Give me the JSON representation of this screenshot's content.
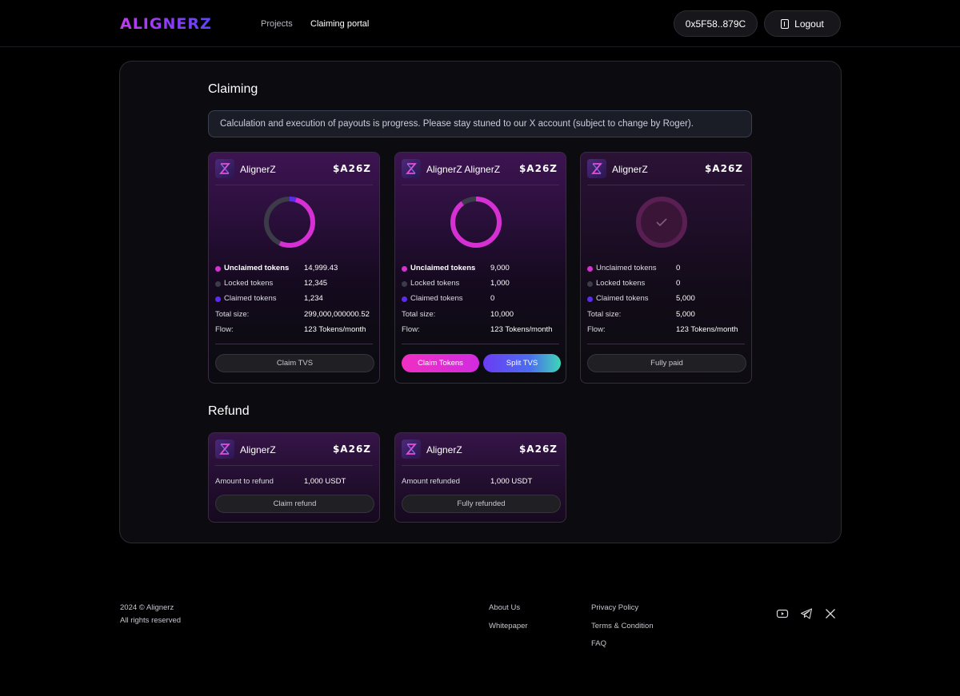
{
  "header": {
    "logo": "ALIGNERZ",
    "nav": [
      {
        "label": "Projects"
      },
      {
        "label": "Claiming portal"
      }
    ],
    "wallet": "0x5F58..879C",
    "logout_label": "Logout"
  },
  "claiming": {
    "title": "Claiming",
    "notice": "Calculation and execution of payouts is progress. Please stay stuned to our X account (subject to change by Roger).",
    "cards": [
      {
        "name": "AlignerZ",
        "ticker": "$A26Z",
        "progress": {
          "unclaimed": 14999.43,
          "locked": 12345,
          "claimed": 1234
        },
        "rows": [
          {
            "label": "Unclaimed tokens",
            "value": "14,999.43"
          },
          {
            "label": "Locked tokens",
            "value": "12,345"
          },
          {
            "label": "Claimed tokens",
            "value": "1,234"
          },
          {
            "label": "Total size:",
            "value": "299,000,000000.52"
          },
          {
            "label": "Flow:",
            "value": "123 Tokens/month"
          }
        ],
        "button": "Claim TVS"
      },
      {
        "name": "AlignerZ  AlignerZ",
        "ticker": "$A26Z",
        "progress": {
          "unclaimed": 9000,
          "locked": 1000,
          "claimed": 0
        },
        "rows": [
          {
            "label": "Unclaimed tokens",
            "value": "9,000"
          },
          {
            "label": "Locked tokens",
            "value": "1,000"
          },
          {
            "label": "Claimed tokens",
            "value": "0"
          },
          {
            "label": "Total size:",
            "value": "10,000"
          },
          {
            "label": "Flow:",
            "value": "123 Tokens/month"
          }
        ],
        "button_primary": "Claim Tokens",
        "button_secondary": "Split TVS"
      },
      {
        "name": "AlignerZ",
        "ticker": "$A26Z",
        "rows": [
          {
            "label": "Unclaimed tokens",
            "value": "0"
          },
          {
            "label": "Locked tokens",
            "value": "0"
          },
          {
            "label": "Claimed tokens",
            "value": "5,000"
          },
          {
            "label": "Total size:",
            "value": "5,000"
          },
          {
            "label": "Flow:",
            "value": "123 Tokens/month"
          }
        ],
        "button": "Fully paid"
      }
    ],
    "legend_colors": {
      "unclaimed": "#d62fd4",
      "locked": "#3c3c48",
      "claimed": "#5b2cf0"
    }
  },
  "refund": {
    "title": "Refund",
    "cards": [
      {
        "name": "AlignerZ",
        "ticker": "$A26Z",
        "label": "Amount to refund",
        "value": "1,000 USDT",
        "button": "Claim refund"
      },
      {
        "name": "AlignerZ",
        "ticker": "$A26Z",
        "label": "Amount refunded",
        "value": "1,000 USDT",
        "button": "Fully refunded"
      }
    ]
  },
  "footer": {
    "copyright": "2024 © Alignerz",
    "rights": "All rights reserved",
    "links_col1": [
      "About Us",
      "Whitepaper"
    ],
    "links_col2": [
      "Privacy Policy",
      "Terms & Condition",
      "FAQ"
    ],
    "socials": [
      "youtube-icon",
      "telegram-icon",
      "x-icon"
    ]
  }
}
